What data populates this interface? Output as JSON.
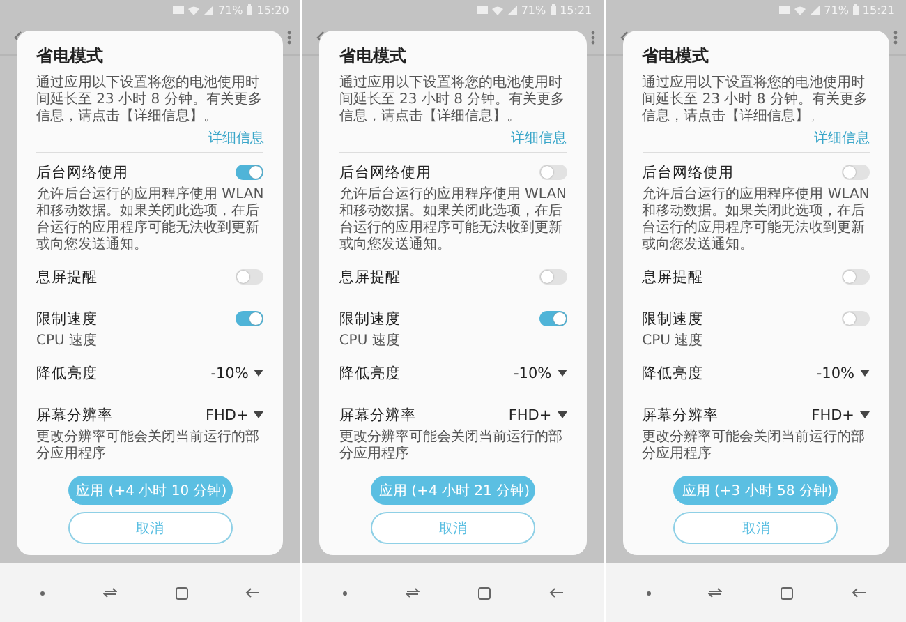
{
  "phones": [
    {
      "status_bar": {
        "battery": "71%",
        "time": "15:20"
      },
      "dialog": {
        "title": "省电模式",
        "description": "通过应用以下设置将您的电池使用时间延长至 23 小时 8 分钟。有关更多信息，请点击【详细信息】。",
        "link": "详细信息",
        "settings": [
          {
            "kind": "toggle",
            "label": "后台网络使用",
            "on": true,
            "description": "允许后台运行的应用程序使用 WLAN 和移动数据。如果关闭此选项，在后台运行的应用程序可能无法收到更新或向您发送通知。"
          },
          {
            "kind": "toggle",
            "label": "息屏提醒",
            "on": false
          },
          {
            "kind": "toggle",
            "label": "限制速度",
            "on": true,
            "description": "CPU 速度"
          },
          {
            "kind": "dropdown",
            "label": "降低亮度",
            "value": "-10%"
          },
          {
            "kind": "dropdown",
            "label": "屏幕分辨率",
            "value": "FHD+",
            "description": "更改分辨率可能会关闭当前运行的部分应用程序"
          }
        ],
        "apply_button": "应用 (+4 小时 10 分钟)",
        "cancel_button": "取消"
      }
    },
    {
      "status_bar": {
        "battery": "71%",
        "time": "15:21"
      },
      "dialog": {
        "title": "省电模式",
        "description": "通过应用以下设置将您的电池使用时间延长至 23 小时 8 分钟。有关更多信息，请点击【详细信息】。",
        "link": "详细信息",
        "settings": [
          {
            "kind": "toggle",
            "label": "后台网络使用",
            "on": false,
            "description": "允许后台运行的应用程序使用 WLAN 和移动数据。如果关闭此选项，在后台运行的应用程序可能无法收到更新或向您发送通知。"
          },
          {
            "kind": "toggle",
            "label": "息屏提醒",
            "on": false
          },
          {
            "kind": "toggle",
            "label": "限制速度",
            "on": true,
            "description": "CPU 速度"
          },
          {
            "kind": "dropdown",
            "label": "降低亮度",
            "value": "-10%"
          },
          {
            "kind": "dropdown",
            "label": "屏幕分辨率",
            "value": "FHD+",
            "description": "更改分辨率可能会关闭当前运行的部分应用程序"
          }
        ],
        "apply_button": "应用 (+4 小时 21 分钟)",
        "cancel_button": "取消"
      }
    },
    {
      "status_bar": {
        "battery": "71%",
        "time": "15:21"
      },
      "dialog": {
        "title": "省电模式",
        "description": "通过应用以下设置将您的电池使用时间延长至 23 小时 8 分钟。有关更多信息，请点击【详细信息】。",
        "link": "详细信息",
        "settings": [
          {
            "kind": "toggle",
            "label": "后台网络使用",
            "on": false,
            "description": "允许后台运行的应用程序使用 WLAN 和移动数据。如果关闭此选项，在后台运行的应用程序可能无法收到更新或向您发送通知。"
          },
          {
            "kind": "toggle",
            "label": "息屏提醒",
            "on": false
          },
          {
            "kind": "toggle",
            "label": "限制速度",
            "on": false,
            "description": "CPU 速度"
          },
          {
            "kind": "dropdown",
            "label": "降低亮度",
            "value": "-10%"
          },
          {
            "kind": "dropdown",
            "label": "屏幕分辨率",
            "value": "FHD+",
            "description": "更改分辨率可能会关闭当前运行的部分应用程序"
          }
        ],
        "apply_button": "应用 (+3 小时 58 分钟)",
        "cancel_button": "取消"
      }
    }
  ]
}
